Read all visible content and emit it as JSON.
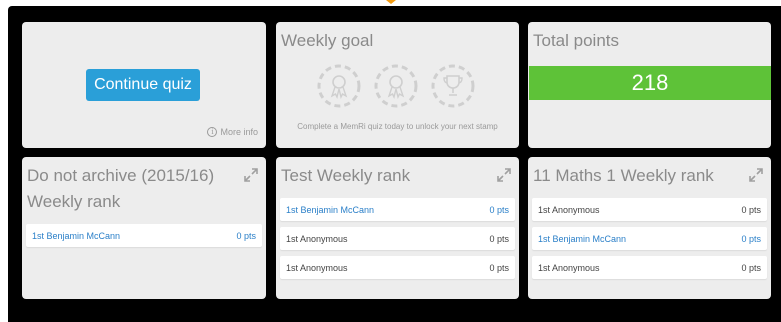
{
  "accent_color": "#f39c12",
  "quiz_card": {
    "continue_label": "Continue quiz",
    "more_info_label": "More info",
    "info_icon": "info-circle-icon"
  },
  "weekly_goal": {
    "title": "Weekly goal",
    "stamps": [
      "ribbon-badge-icon",
      "ribbon-badge-icon",
      "trophy-icon"
    ],
    "message": "Complete a MemRi quiz today to unlock your next stamp"
  },
  "total_points": {
    "title": "Total points",
    "value": "218",
    "bar_color": "#5ec238"
  },
  "leaderboards": [
    {
      "title_line1": "Do not archive (2015/16)",
      "title_line2": "Weekly rank",
      "rows": [
        {
          "name": "1st Benjamin McCann",
          "pts": "0 pts",
          "highlight": true
        }
      ]
    },
    {
      "title_line1": "Test Weekly rank",
      "rows": [
        {
          "name": "1st Benjamin McCann",
          "pts": "0 pts",
          "highlight": true
        },
        {
          "name": "1st Anonymous",
          "pts": "0 pts",
          "highlight": false
        },
        {
          "name": "1st Anonymous",
          "pts": "0 pts",
          "highlight": false
        }
      ]
    },
    {
      "title_line1": "11 Maths 1 Weekly rank",
      "rows": [
        {
          "name": "1st Anonymous",
          "pts": "0 pts",
          "highlight": false
        },
        {
          "name": "1st Benjamin McCann",
          "pts": "0 pts",
          "highlight": true
        },
        {
          "name": "1st Anonymous",
          "pts": "0 pts",
          "highlight": false
        }
      ]
    }
  ]
}
